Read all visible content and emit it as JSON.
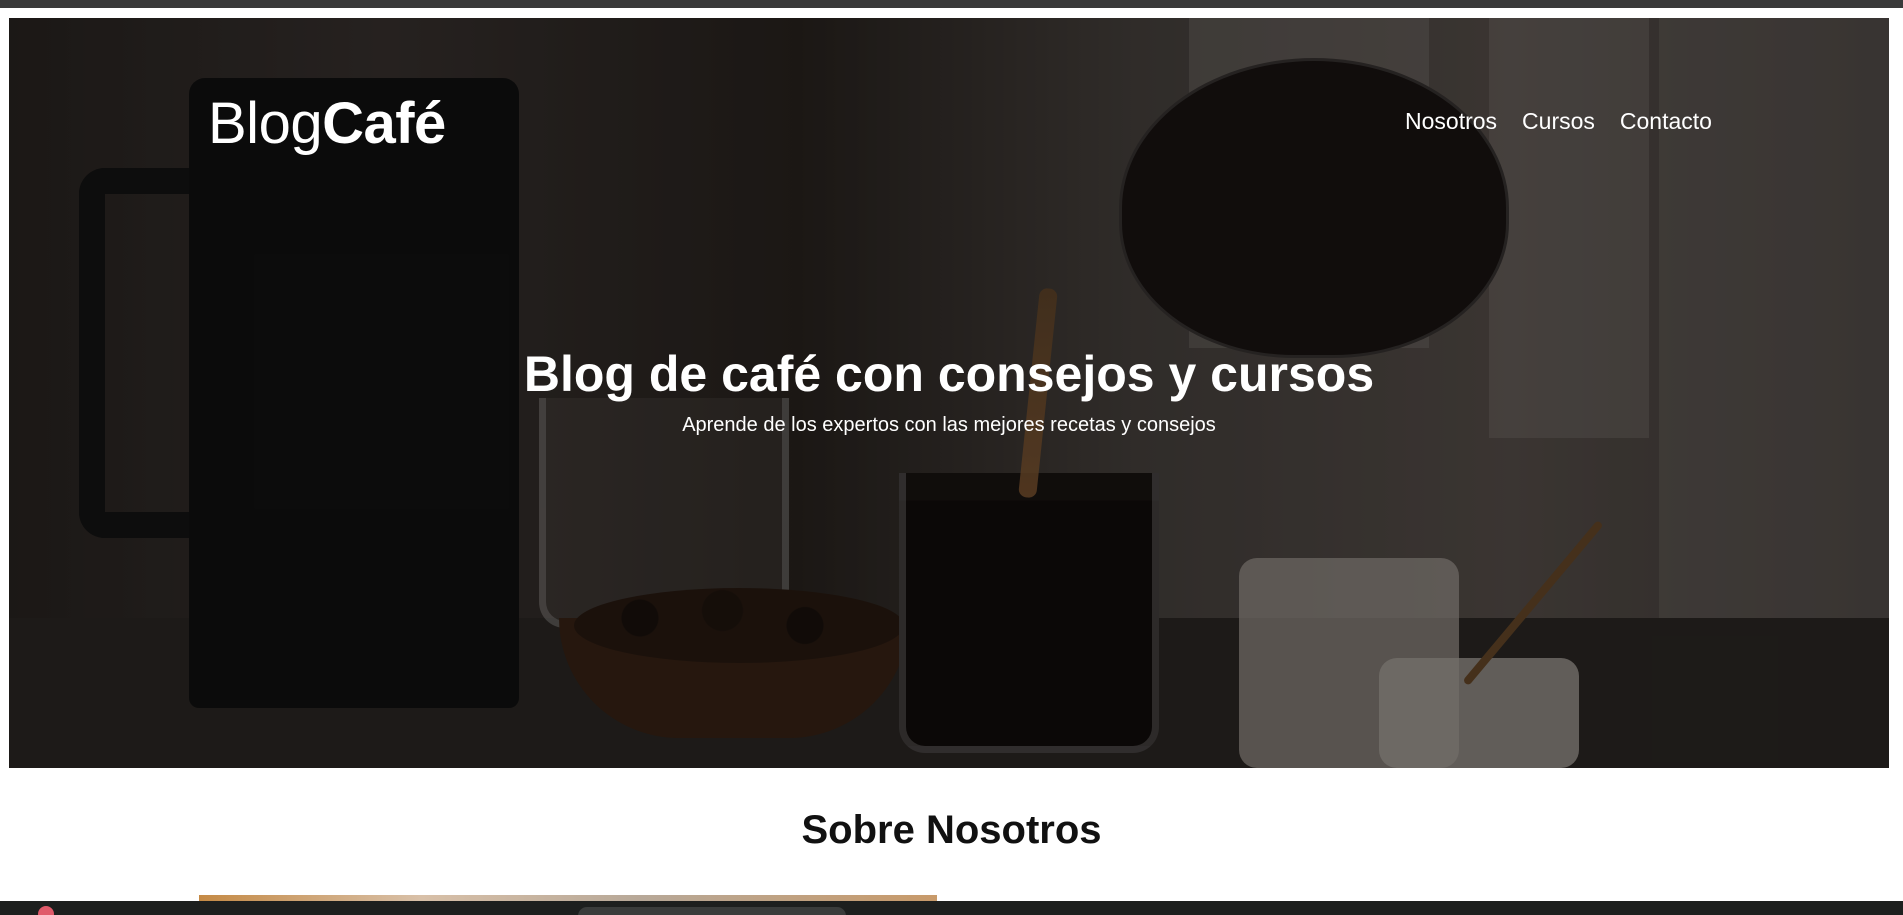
{
  "header": {
    "logo_regular": "Blog",
    "logo_bold": "Café",
    "nav": [
      "Nosotros",
      "Cursos",
      "Contacto"
    ]
  },
  "hero": {
    "title": "Blog de café con consejos y cursos",
    "subtitle": "Aprende de los expertos con las mejores recetas y consejos"
  },
  "about": {
    "title": "Sobre Nosotros"
  }
}
